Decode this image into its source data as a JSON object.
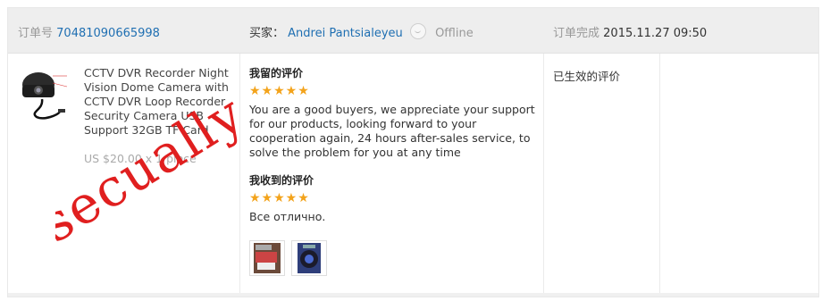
{
  "header": {
    "order_label": "订单号",
    "order_number": "70481090665998",
    "buyer_label": "买家：",
    "buyer_name": "Andrei Pantsialeyeu",
    "online_status": "Offline",
    "completed_label": "订单完成",
    "completed_time": "2015.11.27 09:50"
  },
  "product": {
    "title": "CCTV DVR Recorder Night Vision Dome Camera with CCTV DVR Loop Recorder Security Camera USB Support 32GB TF Card",
    "price": "US $20.00 x 1 piece"
  },
  "my_feedback": {
    "title": "我留的评价",
    "stars": "★★★★★",
    "rating": 5,
    "text": "You are a good buyers, we appreciate your support for our products, looking forward to your cooperation again, 24 hours after-sales service, to solve the problem for you at any time"
  },
  "received_feedback": {
    "title": "我收到的评价",
    "stars": "★★★★★",
    "rating": 5,
    "text": "Все отлично."
  },
  "status": {
    "text": "已生效的评价"
  },
  "watermark": {
    "text": "secually"
  },
  "colors": {
    "header_bg": "#eeeeee",
    "link": "#1f6fb2",
    "star": "#f3a31b",
    "watermark": "#e01f1f"
  }
}
